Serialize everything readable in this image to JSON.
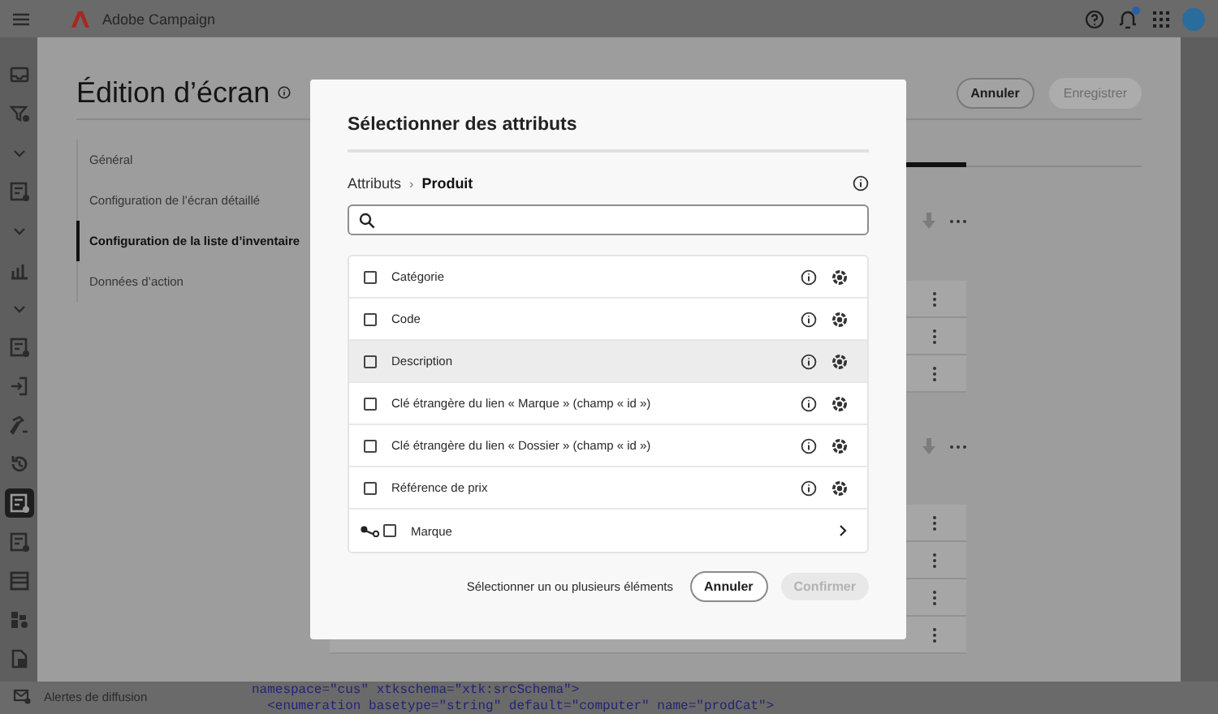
{
  "top_bar": {
    "product": "Adobe Campaign",
    "notification_badge": true
  },
  "nav_rail": [
    {
      "kind": "inbox",
      "selected": false
    },
    {
      "kind": "filter",
      "selected": false
    },
    {
      "kind": "chevron",
      "selected": false
    },
    {
      "kind": "list",
      "selected": false
    },
    {
      "kind": "chevron",
      "selected": false
    },
    {
      "kind": "chart",
      "selected": false
    },
    {
      "kind": "chevron",
      "selected": false
    },
    {
      "kind": "list",
      "selected": false
    },
    {
      "kind": "signin",
      "selected": false
    },
    {
      "kind": "hammer",
      "selected": false
    },
    {
      "kind": "history",
      "selected": false
    },
    {
      "kind": "list",
      "selected": true
    },
    {
      "kind": "list",
      "selected": false
    },
    {
      "kind": "table",
      "selected": false
    },
    {
      "kind": "blocks",
      "selected": false
    },
    {
      "kind": "doc",
      "selected": false
    }
  ],
  "page": {
    "title": "Édition d’écran",
    "cancel": "Annuler",
    "save": {
      "label": "Enregistrer",
      "disabled": true
    }
  },
  "sections": [
    {
      "label": "Général",
      "selected": false
    },
    {
      "label": "Configuration de l’écran détaillé",
      "selected": false
    },
    {
      "label": "Configuration de la liste d’inventaire",
      "selected": true
    },
    {
      "label": "Données d’action",
      "selected": false
    }
  ],
  "bottom": {
    "nav_label": "Alertes de diffusion",
    "code_lines": [
      "namespace=\"cus\" xtkschema=\"xtk:srcSchema\">",
      "  <enumeration basetype=\"string\" default=\"computer\" name=\"prodCat\">"
    ]
  },
  "dialog": {
    "title": "Sélectionner des attributs",
    "breadcrumb_separator": "›",
    "breadcrumb": [
      {
        "label": "Attributs",
        "current": false
      },
      {
        "label": "Produit",
        "current": true
      }
    ],
    "attributes": [
      {
        "kind": "field",
        "label": "Catégorie",
        "checked": false,
        "highlighted": false
      },
      {
        "kind": "field",
        "label": "Code",
        "checked": false,
        "highlighted": false
      },
      {
        "kind": "field",
        "label": "Description",
        "checked": false,
        "highlighted": true
      },
      {
        "kind": "field",
        "label": "Clé étrangère du lien « Marque » (champ « id »)",
        "checked": false,
        "highlighted": false
      },
      {
        "kind": "field",
        "label": "Clé étrangère du lien « Dossier » (champ « id »)",
        "checked": false,
        "highlighted": false
      },
      {
        "kind": "field",
        "label": "Référence de prix",
        "checked": false,
        "highlighted": false
      },
      {
        "kind": "link",
        "label": "Marque",
        "checked": false,
        "highlighted": false
      }
    ],
    "hint": "Sélectionner un ou plusieurs éléments",
    "cancel": "Annuler",
    "confirm": {
      "label": "Confirmer",
      "disabled": true
    }
  }
}
